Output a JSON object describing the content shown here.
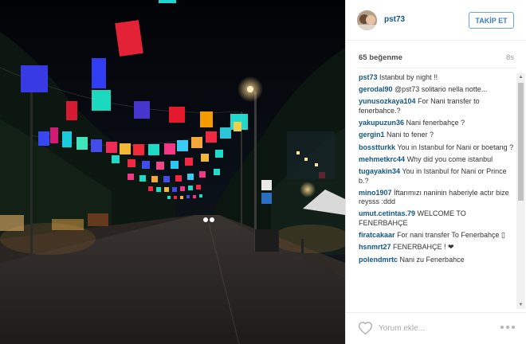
{
  "post": {
    "username": "pst73",
    "follow_label": "TAKİP ET",
    "likes_text": "65 beğenme",
    "time_ago": "8s"
  },
  "comments": [
    {
      "user": "pst73",
      "text": "Istanbul by night !!"
    },
    {
      "user": "gerodal90",
      "text": "@pst73 solitario nella notte..."
    },
    {
      "user": "yunusozkaya104",
      "text": "For Nani transfer to fenerbahce.?"
    },
    {
      "user": "yakupuzun36",
      "text": "Nani fenerbahçe ?"
    },
    {
      "user": "gergin1",
      "text": "Nani to fener ?"
    },
    {
      "user": "bosstturkk",
      "text": "You in Istanbul for Nani or boetang ?"
    },
    {
      "user": "mehmetkrc44",
      "text": "Why did you come istanbul"
    },
    {
      "user": "tugayakin34",
      "text": "You in Istanbul for Nani or Prince b.?"
    },
    {
      "user": "mino1907",
      "text": "İftarımızı naninin haberiyle actır bize reysss :ddd"
    },
    {
      "user": "umut.cetintas.79",
      "text": "WELCOME TO FENERBAHÇE"
    },
    {
      "user": "firatcakaar",
      "text": "For nani transfer To Fenerbahçe ▯"
    },
    {
      "user": "hsnmrt27",
      "text": "FENERBAHÇE ! ❤"
    },
    {
      "user": "polendmrtc",
      "text": "Nani zu Fenerbahce"
    }
  ],
  "footer": {
    "comment_placeholder": "Yorum ekle..."
  },
  "icons": {
    "like": "heart-icon",
    "options": "more-options-icon",
    "scroll_up": "scroll-up-arrow-icon",
    "scroll_down": "scroll-down-arrow-icon"
  },
  "colors": {
    "link": "#125688",
    "follow_border": "#6fa3cf",
    "follow_text": "#3b7dbd"
  }
}
